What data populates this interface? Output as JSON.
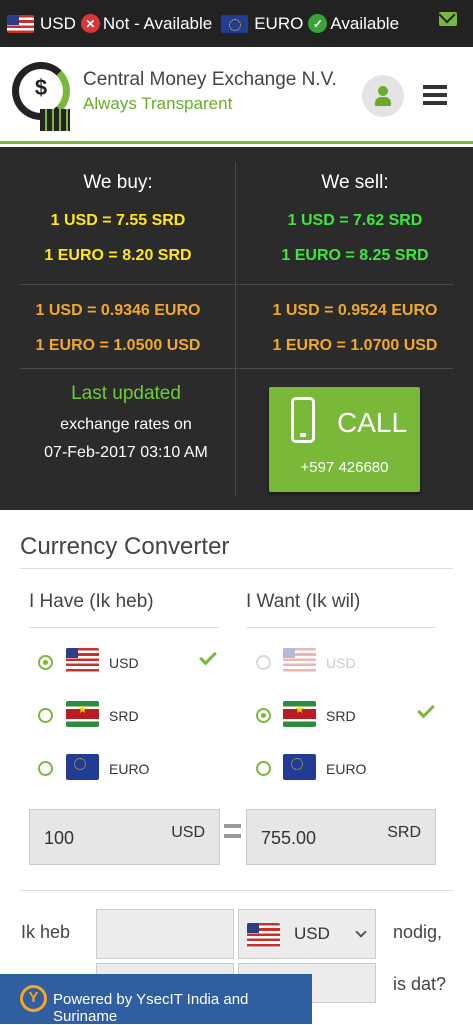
{
  "topbar": {
    "usd_code": "USD",
    "usd_status": "Not - Available",
    "euro_code": "EURO",
    "euro_status": "Available",
    "icons": [
      "flag-us-icon",
      "x-circle-icon",
      "flag-eu-icon",
      "check-circle-icon",
      "mail-icon"
    ]
  },
  "header": {
    "logo_symbol": "$",
    "company_name": "Central Money Exchange N.V.",
    "tagline": "Always Transparent"
  },
  "rates": {
    "buy_label": "We buy:",
    "sell_label": "We sell:",
    "buy_usd": "1 USD = 7.55 SRD",
    "buy_euro": "1 EURO = 8.20 SRD",
    "sell_usd": "1 USD = 7.62 SRD",
    "sell_euro": "1 EURO = 8.25 SRD",
    "buy_cross_usd": "1 USD = 0.9346 EURO",
    "buy_cross_euro": "1 EURO = 1.0500 USD",
    "sell_cross_usd": "1 USD = 0.9524 EURO",
    "sell_cross_euro": "1 EURO = 1.0700 USD",
    "last_updated": "Last updated",
    "exchange_rates_on": "exchange rates on",
    "updated_date": "07-Feb-2017 03:10 AM",
    "call_label": "CALL",
    "call_number": "+597 426680"
  },
  "converter": {
    "title": "Currency Converter",
    "have_label": "I Have (Ik heb)",
    "want_label": "I Want (Ik wil)",
    "currencies": [
      "USD",
      "SRD",
      "EURO"
    ],
    "have_selected": "USD",
    "want_selected": "SRD",
    "want_disabled": "USD",
    "have_amount": "100",
    "have_currency": "USD",
    "want_amount": "755.00",
    "want_currency": "SRD"
  },
  "form": {
    "ik_heb": "Ik heb",
    "select_currency": "USD",
    "nodig": "nodig,",
    "is_dat": "is dat?"
  },
  "footer": {
    "powered_by": "Powered by YsecIT India and Suriname"
  },
  "colors": {
    "accent_green": "#7ab83a",
    "dark_bg": "#2b2b2b",
    "buy_rate": "#ffe620",
    "sell_rate": "#3ee63e",
    "cross_rate": "#f0a830",
    "footer_blue": "#2f5fa0"
  }
}
